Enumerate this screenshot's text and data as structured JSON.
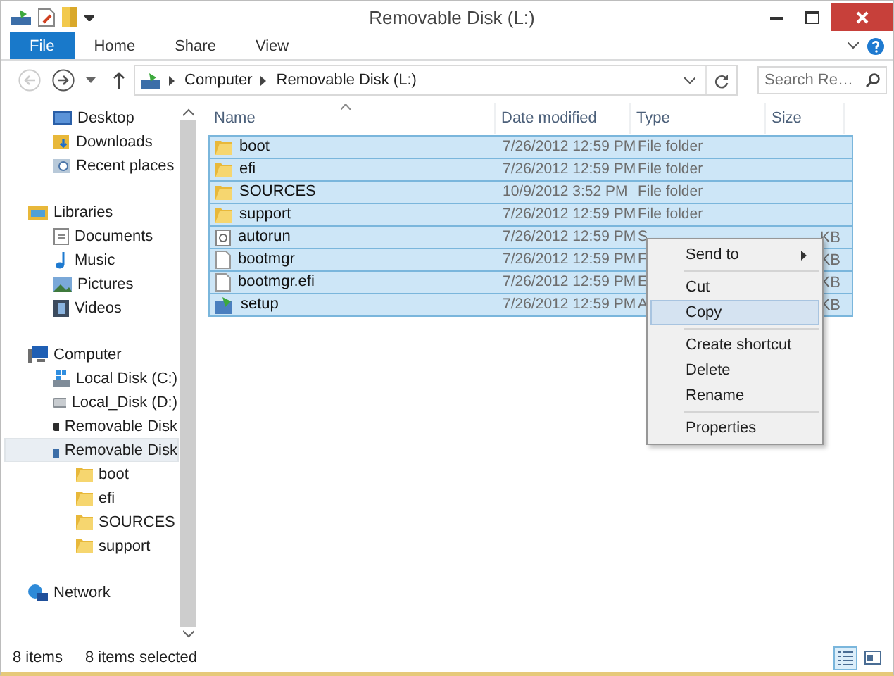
{
  "window": {
    "title": "Removable Disk (L:)"
  },
  "ribbon_tabs": [
    {
      "label": "File",
      "kind": "file"
    },
    {
      "label": "Home",
      "kind": "tab"
    },
    {
      "label": "Share",
      "kind": "tab"
    },
    {
      "label": "View",
      "kind": "tab"
    }
  ],
  "address_bar": {
    "crumbs": [
      "Computer",
      "Removable Disk (L:)"
    ]
  },
  "search": {
    "placeholder": "Search Re…"
  },
  "sidebar": {
    "tree": [
      {
        "children": [
          {
            "label": "Desktop",
            "kind": "desktop",
            "selected": false
          },
          {
            "label": "Downloads",
            "kind": "downloads",
            "selected": false
          },
          {
            "label": "Recent places",
            "kind": "recent",
            "selected": false
          }
        ]
      },
      {
        "label": "Libraries",
        "kind": "libraries",
        "selected": false,
        "children": [
          {
            "label": "Documents",
            "kind": "document",
            "selected": false
          },
          {
            "label": "Music",
            "kind": "music",
            "selected": false
          },
          {
            "label": "Pictures",
            "kind": "pictures",
            "selected": false
          },
          {
            "label": "Videos",
            "kind": "videos",
            "selected": false
          }
        ]
      },
      {
        "label": "Computer",
        "kind": "computer",
        "selected": false,
        "children": [
          {
            "label": "Local Disk (C:)",
            "kind": "system-drive",
            "selected": false
          },
          {
            "label": "Local_Disk (D:)",
            "kind": "drive",
            "selected": false
          },
          {
            "label": "Removable Disk",
            "kind": "removable",
            "selected": false
          },
          {
            "label": "Removable Disk",
            "kind": "usb",
            "selected": true,
            "children": [
              {
                "label": "boot",
                "kind": "folder",
                "selected": false
              },
              {
                "label": "efi",
                "kind": "folder",
                "selected": false
              },
              {
                "label": "SOURCES",
                "kind": "folder",
                "selected": false
              },
              {
                "label": "support",
                "kind": "folder",
                "selected": false
              }
            ]
          }
        ]
      },
      {
        "label": "Network",
        "kind": "network",
        "selected": false
      }
    ]
  },
  "table": {
    "columns": [
      "Name",
      "Date modified",
      "Type",
      "Size"
    ],
    "rows": [
      {
        "name": "boot",
        "kind": "folder",
        "date": "7/26/2012 12:59 PM",
        "type": "File folder",
        "selected": true
      },
      {
        "name": "efi",
        "kind": "folder",
        "date": "7/26/2012 12:59 PM",
        "type": "File folder",
        "selected": true
      },
      {
        "name": "SOURCES",
        "kind": "folder",
        "date": "10/9/2012 3:52 PM",
        "type": "File folder",
        "selected": true
      },
      {
        "name": "support",
        "kind": "folder",
        "date": "7/26/2012 12:59 PM",
        "type": "File folder",
        "selected": true
      },
      {
        "name": "autorun",
        "kind": "settings",
        "date": "7/26/2012 12:59 PM",
        "type": "S",
        "size": "KB",
        "selected": true
      },
      {
        "name": "bootmgr",
        "kind": "file",
        "date": "7/26/2012 12:59 PM",
        "type": "F",
        "size": "KB",
        "selected": true
      },
      {
        "name": "bootmgr.efi",
        "kind": "file",
        "date": "7/26/2012 12:59 PM",
        "type": "E",
        "size": "KB",
        "selected": true
      },
      {
        "name": "setup",
        "kind": "setup",
        "date": "7/26/2012 12:59 PM",
        "type": "A",
        "size": "KB",
        "selected": true
      }
    ]
  },
  "context_menu": {
    "items": [
      {
        "label": "Send to",
        "kind": "submenu",
        "selected": false
      },
      {
        "kind": "separator"
      },
      {
        "label": "Cut",
        "kind": "item",
        "selected": false
      },
      {
        "label": "Copy",
        "kind": "item",
        "selected": true
      },
      {
        "kind": "separator"
      },
      {
        "label": "Create shortcut",
        "kind": "item",
        "selected": false
      },
      {
        "label": "Delete",
        "kind": "item",
        "selected": false
      },
      {
        "label": "Rename",
        "kind": "item",
        "selected": false
      },
      {
        "kind": "separator"
      },
      {
        "label": "Properties",
        "kind": "item",
        "selected": false
      }
    ]
  },
  "status_bar": {
    "count": "8 items",
    "selection": "8 items selected",
    "views": [
      {
        "kind": "details",
        "selected": true
      },
      {
        "kind": "tiles",
        "selected": false
      }
    ]
  }
}
